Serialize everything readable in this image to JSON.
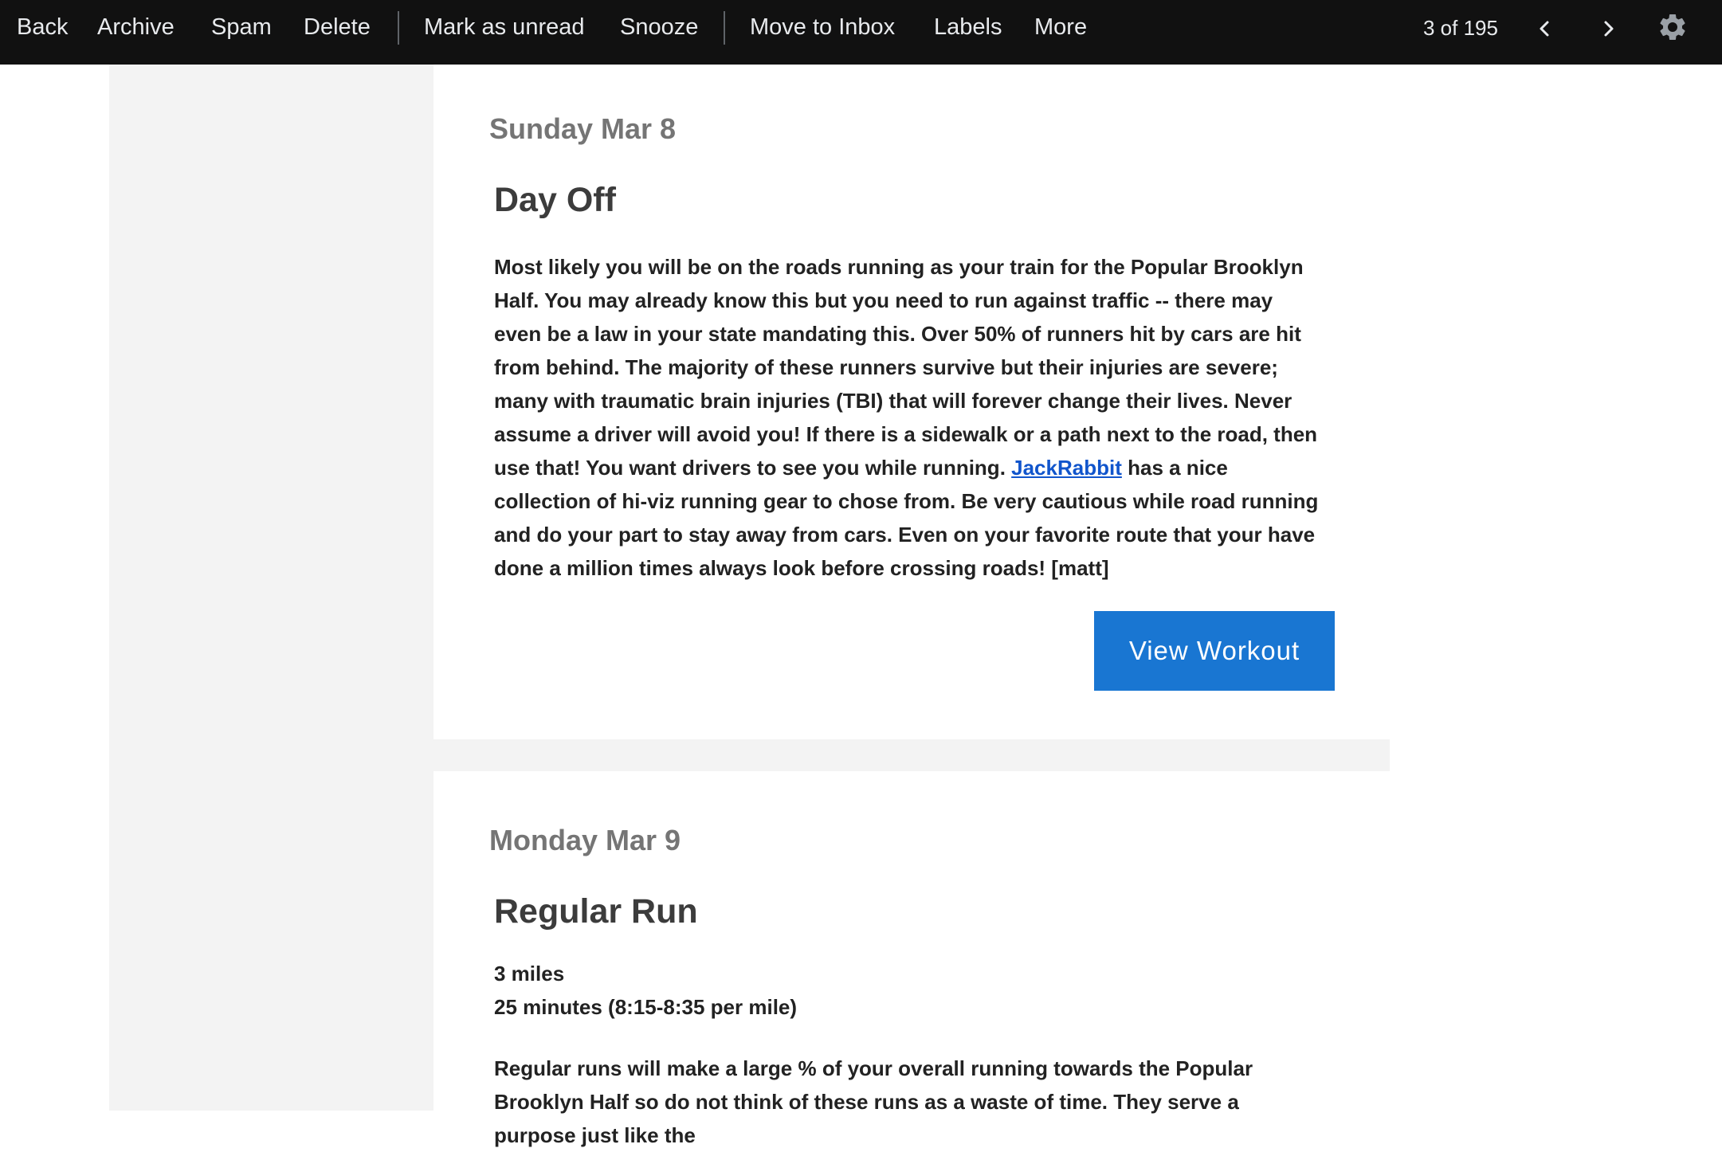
{
  "toolbar": {
    "back": "Back",
    "archive": "Archive",
    "spam": "Spam",
    "delete": "Delete",
    "mark_unread": "Mark as unread",
    "snooze": "Snooze",
    "move_inbox": "Move to Inbox",
    "labels": "Labels",
    "more": "More",
    "counter": "3 of 195",
    "icons": [
      "chevron-left-icon",
      "chevron-right-icon",
      "gear-icon"
    ]
  },
  "cards": [
    {
      "day": "Sunday Mar 8",
      "title": "Day Off",
      "body_before_link": "Most likely you will be on the roads running as your train for the Popular Brooklyn Half. You may already know this but you need to run against traffic -- there may even be a law in your state mandating this. Over 50% of runners hit by cars are hit from behind. The majority of these runners survive but their injuries are severe; many with traumatic brain injuries (TBI) that will forever change their lives. Never assume a driver will avoid you! If there is a sidewalk or a path next to the road, then use that! You want drivers to see you while running. ",
      "link": "JackRabbit",
      "body_after_link": " has a nice collection of hi-viz running gear to chose from. Be very cautious while road running and do your part to stay away from cars. Even on your favorite route that your have done a million times always look before crossing roads! [matt]",
      "button": "View Workout"
    },
    {
      "day": "Monday Mar 9",
      "title": "Regular Run",
      "distance": "3 miles",
      "duration": "25 minutes (8:15-8:35 per mile)",
      "body": "Regular runs will make a large % of your overall running towards the Popular Brooklyn Half so do not think of these runs as a waste of time. They serve a purpose just like the"
    }
  ],
  "colors": {
    "toolbar_bg": "#111111",
    "button_blue": "#1976d2",
    "link": "#1155cc",
    "page_bg": "#f3f3f3"
  }
}
